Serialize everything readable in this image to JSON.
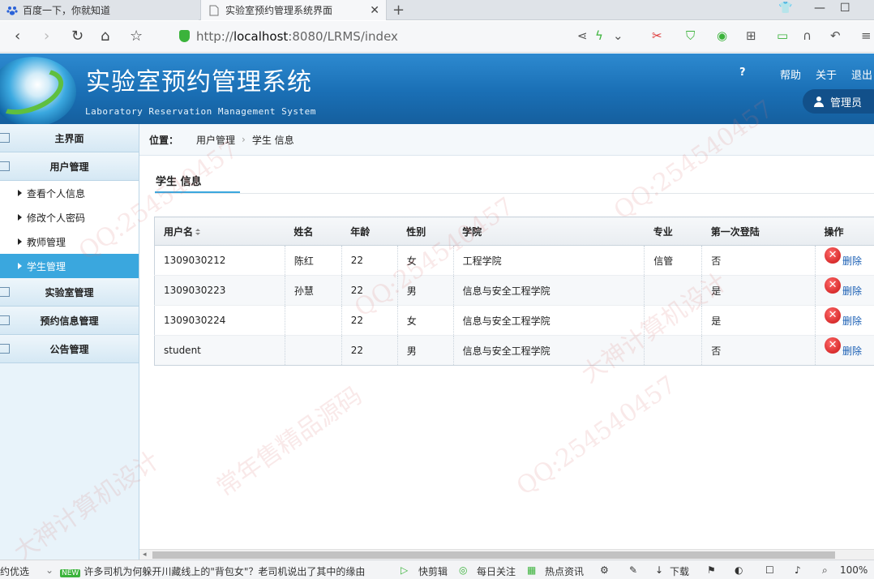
{
  "browser": {
    "tabs": [
      {
        "title": "百度一下，你就知道",
        "active": false
      },
      {
        "title": "实验室预约管理系统界面",
        "active": true
      }
    ],
    "url_prefix": "http://",
    "url_host": "localhost",
    "url_path": ":8080/LRMS/index"
  },
  "header": {
    "title": "实验室预约管理系统",
    "subtitle": "Laboratory Reservation Management System",
    "help_icon": "?",
    "links": [
      "帮助",
      "关于",
      "退出"
    ],
    "user": "管理员"
  },
  "sidebar": {
    "main": "主界面",
    "user_mgmt": "用户管理",
    "sub_items": [
      "查看个人信息",
      "修改个人密码",
      "教师管理",
      "学生管理"
    ],
    "active_sub": "学生管理",
    "lab_mgmt": "实验室管理",
    "reservation_mgmt": "预约信息管理",
    "notice_mgmt": "公告管理"
  },
  "breadcrumb": {
    "label": "位置：",
    "items": [
      "用户管理",
      "学生 信息"
    ],
    "separator": "›"
  },
  "section": {
    "title": "学生 信息"
  },
  "table": {
    "headers": [
      "用户名",
      "姓名",
      "年龄",
      "性别",
      "学院",
      "专业",
      "第一次登陆",
      "操作"
    ],
    "rows": [
      {
        "username": "1309030212",
        "name": "陈红",
        "age": "22",
        "gender": "女",
        "college": "工程学院",
        "major": "信管",
        "first_login": "否",
        "action": "删除"
      },
      {
        "username": "1309030223",
        "name": "孙慧",
        "age": "22",
        "gender": "男",
        "college": "信息与安全工程学院",
        "major": "",
        "first_login": "是",
        "action": "删除"
      },
      {
        "username": "1309030224",
        "name": "",
        "age": "22",
        "gender": "女",
        "college": "信息与安全工程学院",
        "major": "",
        "first_login": "是",
        "action": "删除"
      },
      {
        "username": "student",
        "name": "",
        "age": "22",
        "gender": "男",
        "college": "信息与安全工程学院",
        "major": "",
        "first_login": "否",
        "action": "删除"
      }
    ]
  },
  "statusbar": {
    "left": "约优选",
    "news_badge": "NEW",
    "news": "许多司机为何躲开川藏线上的\"背包女\"？老司机说出了其中的缘由",
    "items": [
      "快剪辑",
      "每日关注",
      "热点资讯",
      "下载"
    ],
    "zoom": "100%"
  },
  "watermarks": [
    "QQ:254540457",
    "常年售精品源码",
    "大神计算机设计"
  ],
  "colors": {
    "header_blue": "#1a6fb5",
    "active_menu": "#3aa7de",
    "delete_red": "#c81414",
    "link_blue": "#1a5fb4"
  }
}
